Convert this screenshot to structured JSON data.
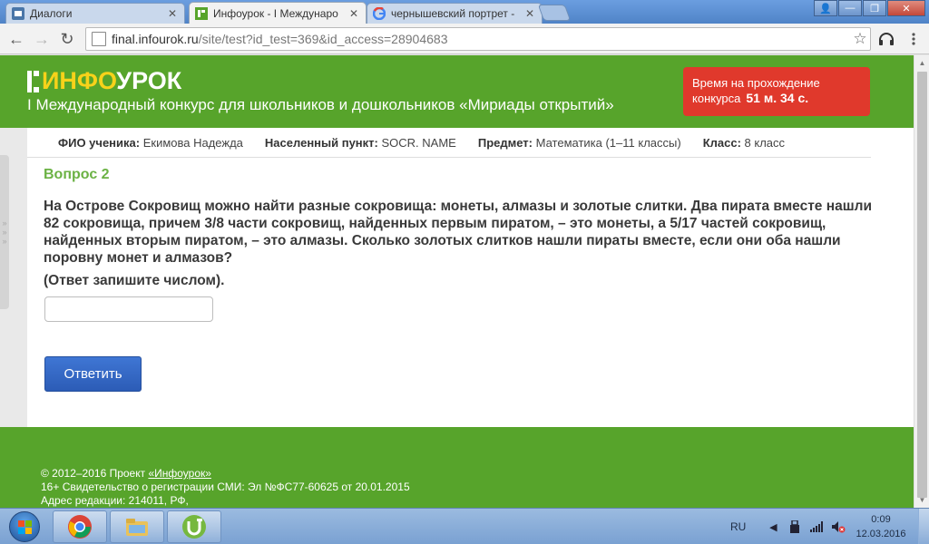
{
  "browser": {
    "tabs": [
      {
        "title": "Диалоги",
        "icon": "vk-icon"
      },
      {
        "title": "Инфоурок - I Междунаро",
        "icon": "infourok-icon"
      },
      {
        "title": "чернышевский портрет -",
        "icon": "google-icon"
      }
    ],
    "url_host": "final.infourok.ru",
    "url_path": "/site/test?id_test=369&id_access=28904683"
  },
  "page": {
    "logo_prefix": "ИНФО",
    "logo_suffix": "УРОК",
    "subtitle": "I Международный конкурс для школьников и дошкольников «Мириады открытий»",
    "timer": {
      "label_line1": "Время на прохождение",
      "label_line2": "конкурса",
      "value": "51 м. 34 с."
    },
    "info": {
      "student_label": "ФИО ученика:",
      "student_value": "Екимова Надежда",
      "city_label": "Населенный пункт:",
      "city_value": "SOCR. NAME",
      "subject_label": "Предмет:",
      "subject_value": "Математика (1–11 классы)",
      "grade_label": "Класс:",
      "grade_value": "8 класс"
    },
    "question": {
      "title": "Вопрос 2",
      "text": "На Острове Сокровищ можно найти разные сокровища: монеты, алмазы и золотые слитки. Два пирата вместе нашли 82 сокровища, причем 3/8 части сокровищ, найденных первым пиратом, – это монеты, а 5/17 частей сокровищ, найденных вторым пиратом, – это алмазы. Сколько золотых слитков нашли пираты вместе, если они оба нашли поровну монет и алмазов?",
      "hint": "(Ответ запишите числом).",
      "answer_value": "",
      "submit_label": "Ответить"
    },
    "footer": {
      "line1_prefix": "© 2012–2016 Проект ",
      "line1_link": "«Инфоурок»",
      "line2": "16+ Свидетельство о регистрации СМИ: Эл №ФС77-60625 от 20.01.2015",
      "line3": "Адрес редакции: 214011, РФ,"
    }
  },
  "taskbar": {
    "apps": [
      "chrome-icon",
      "explorer-icon",
      "utorrent-icon"
    ],
    "language": "RU",
    "time": "0:09",
    "date": "12.03.2016"
  },
  "colors": {
    "brand_green": "#57a42b",
    "logo_accent": "#f7d21a",
    "timer_red": "#e0392c",
    "question_title_green": "#6bb244",
    "button_blue": "#2c5cb6"
  }
}
